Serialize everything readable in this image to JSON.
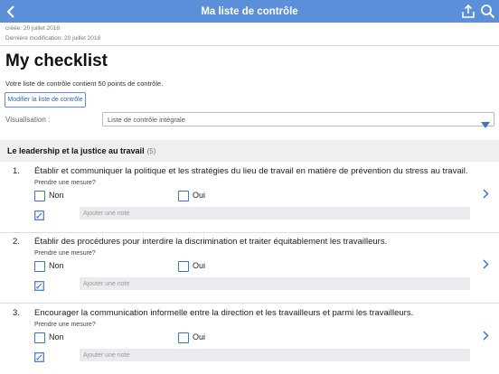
{
  "header": {
    "title": "Ma liste de contrôle",
    "icons": {
      "back": "chevron-left-icon",
      "share": "share-icon",
      "search": "search-icon"
    },
    "color": "#5b8fd9"
  },
  "meta": {
    "created": "créée: 20 juillet 2018",
    "modified": "Dernière modification: 20 juillet 2018"
  },
  "checklist": {
    "title": "My checklist",
    "summary": "Votre liste de contrôle contient 50 points de contrôle.",
    "edit_label": "Modifier la liste de contrôle"
  },
  "visualisation": {
    "label": "Visualisation :",
    "selected": "Liste de contrôle intégrale"
  },
  "section": {
    "name": "Le leadership et la justice au travail",
    "count": "(5)"
  },
  "items": [
    {
      "number": "1.",
      "question": "Établir et communiquer la politique et les stratégies du lieu de travail en matière de prévention du stress au travail.",
      "prompt": "Prendre une mesure?",
      "option_no": "Non",
      "option_yes": "Oui",
      "note_placeholder": "Ajouter une note"
    },
    {
      "number": "2.",
      "question": "Établir des procédures pour interdire la discrimination et traiter équitablement les travailleurs.",
      "prompt": "Prendre une mesure?",
      "option_no": "Non",
      "option_yes": "Oui",
      "note_placeholder": "Ajouter une note"
    },
    {
      "number": "3.",
      "question": "Encourager la communication informelle entre la direction et les travailleurs et parmi les travailleurs.",
      "prompt": "Prendre une mesure?",
      "option_no": "Non",
      "option_yes": "Oui",
      "note_placeholder": "Ajouter une note"
    }
  ],
  "colors": {
    "accent": "#3f75c9",
    "section_bg": "#efefef",
    "note_bg": "#ebebef"
  }
}
